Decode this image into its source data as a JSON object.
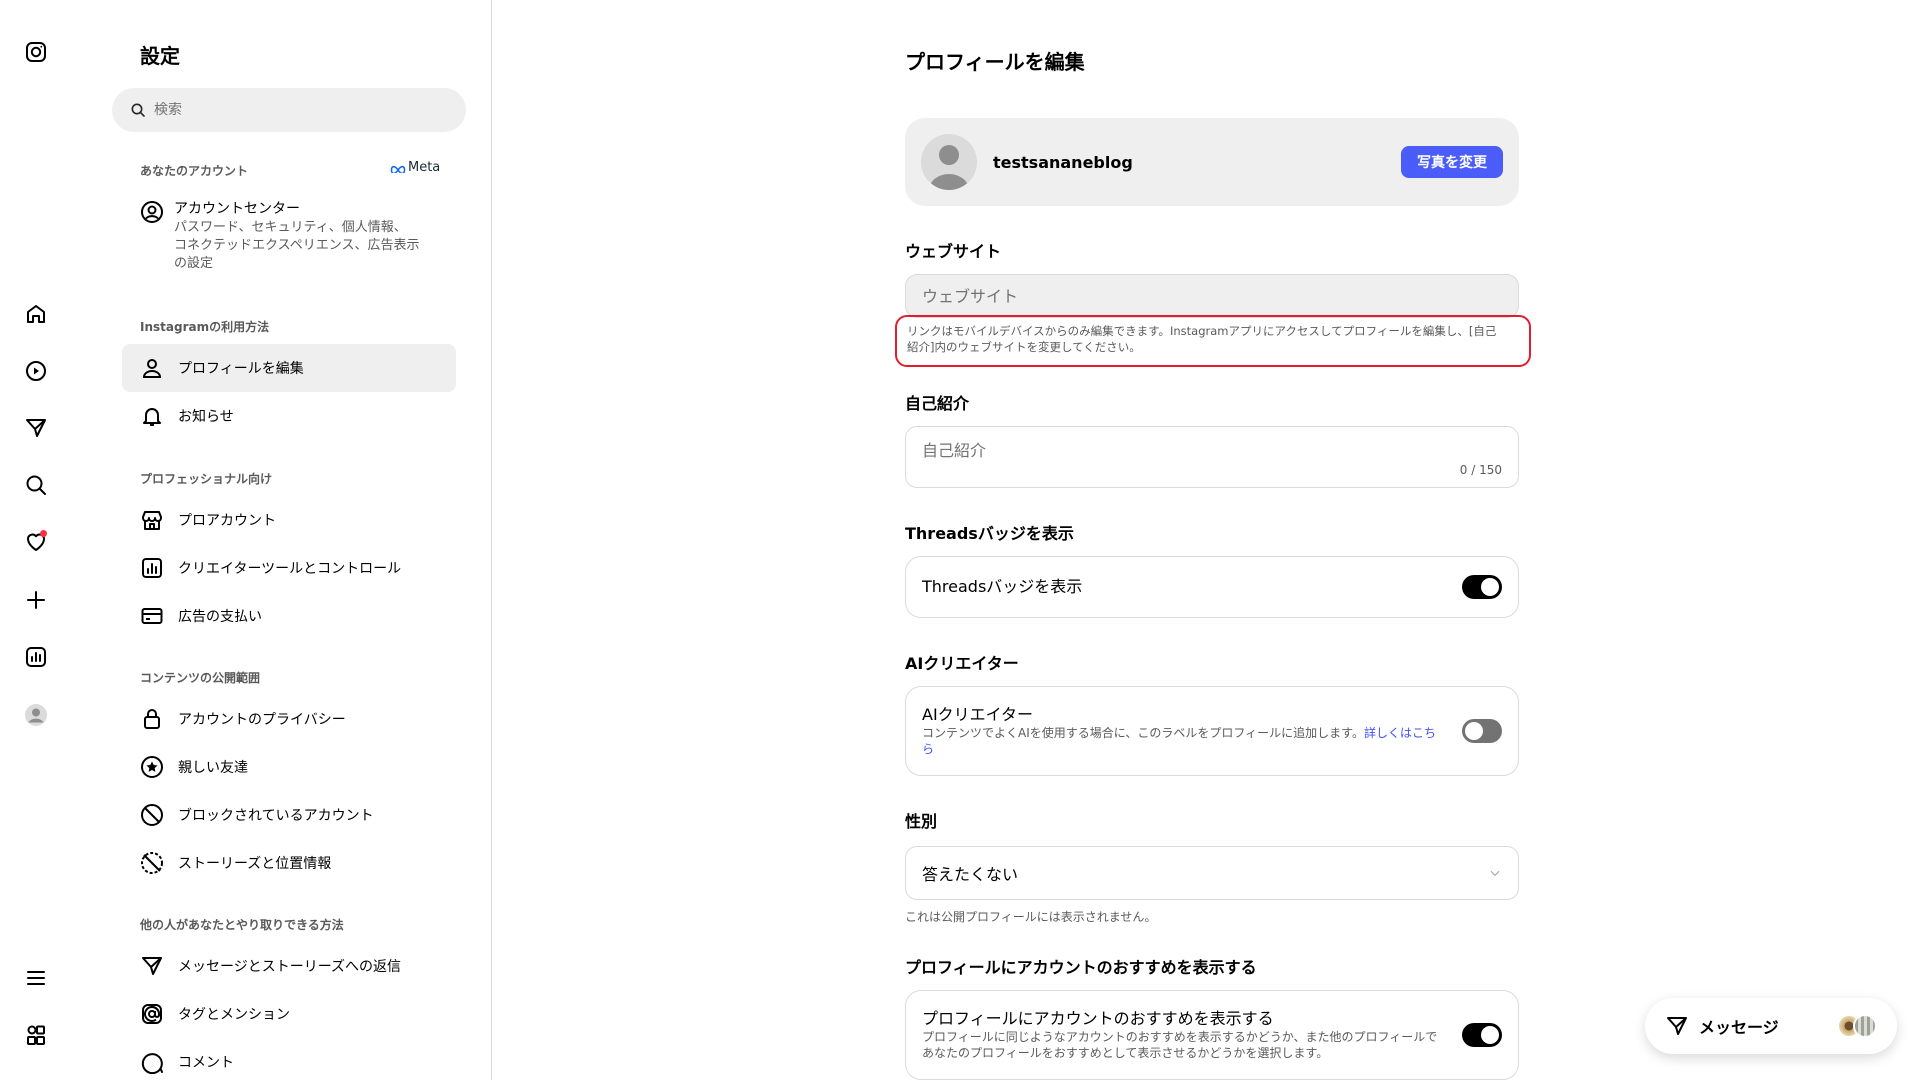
{
  "rail": {
    "items": [
      "instagram-logo",
      "home",
      "reels",
      "direct-messages",
      "search",
      "notifications",
      "create",
      "insights",
      "profile",
      "more",
      "also-from-meta"
    ]
  },
  "settings": {
    "title": "設定",
    "search_placeholder": "検索",
    "your_account": {
      "heading": "あなたのアカウント",
      "meta_label": "Meta",
      "account_center_title": "アカウントセンター",
      "account_center_sub_1": "パスワード、セキュリティ、個人情報、",
      "account_center_sub_2": "コネクテッドエクスペリエンス、広告表示",
      "account_center_sub_3": "の設定"
    },
    "how_you_use": {
      "heading": "Instagramの利用方法",
      "items": [
        "プロフィールを編集",
        "お知らせ"
      ]
    },
    "professional": {
      "heading": "プロフェッショナル向け",
      "items": [
        "プロアカウント",
        "クリエイターツールとコントロール",
        "広告の支払い"
      ]
    },
    "content_visibility": {
      "heading": "コンテンツの公開範囲",
      "items": [
        "アカウントのプライバシー",
        "親しい友達",
        "ブロックされているアカウント",
        "ストーリーズと位置情報"
      ]
    },
    "interactions": {
      "heading": "他の人があなたとやり取りできる方法",
      "items": [
        "メッセージとストーリーズへの返信",
        "タグとメンション",
        "コメント"
      ]
    }
  },
  "main": {
    "title": "プロフィールを編集",
    "username": "testsananeblog",
    "change_photo": "写真を変更",
    "website": {
      "label": "ウェブサイト",
      "placeholder": "ウェブサイト",
      "help_1": "リンクはモバイルデバイスからのみ編集できます。Instagramアプリにアクセスしてプロフィールを編集し、[自己",
      "help_2": "紹介]内のウェブサイトを変更してください。"
    },
    "bio": {
      "label": "自己紹介",
      "placeholder": "自己紹介",
      "count": "0 / 150"
    },
    "threads": {
      "label": "Threadsバッジを表示",
      "toggle_label": "Threadsバッジを表示",
      "on": true
    },
    "ai": {
      "label": "AIクリエイター",
      "toggle_label": "AIクリエイター",
      "sub": "コンテンツでよくAIを使用する場合に、このラベルをプロフィールに追加します。",
      "link": "詳しくはこちら",
      "on": false
    },
    "gender": {
      "label": "性別",
      "value": "答えたくない",
      "note": "これは公開プロフィールには表示されません。"
    },
    "suggestions": {
      "label": "プロフィールにアカウントのおすすめを表示する",
      "toggle_label": "プロフィールにアカウントのおすすめを表示する",
      "sub_1": "プロフィールに同じようなアカウントのおすすめを表示するかどうか、また他のプロフィールで",
      "sub_2": "あなたのプロフィールをおすすめとして表示させるかどうかを選択します。",
      "on": true
    }
  },
  "messages": {
    "label": "メッセージ"
  },
  "colors": {
    "accent": "#4a5df9",
    "highlight_border": "#e11d2e",
    "notification_dot": "#ff3040",
    "link": "#4150f7"
  }
}
